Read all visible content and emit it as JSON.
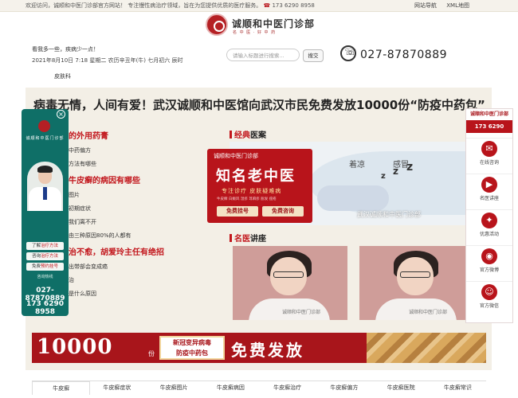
{
  "topbar": {
    "welcome": "欢迎访问，诚顺和中医门诊部官方网站！ 专注慢性病治疗领域，旨在为您提供优质的医疗服务。",
    "phone": "173 6290 8958",
    "links": [
      "网站导航",
      "XML地图"
    ]
  },
  "logo": {
    "name": "诚顺和中医门诊部",
    "tagline": "名 中 医 · 好 中 药"
  },
  "header": {
    "motto": "看我多一些，疾病少一点！",
    "date": "2021年8月10日 7:18 星期二 农历辛丑年(牛) 七月初六 辰时",
    "search_placeholder": "请输入标题进行搜索...",
    "search_button": "搜交",
    "hotline": "027-87870889",
    "nav_item": "皮肤科"
  },
  "headline": "病毒无情，人间有爱！武汉诚顺和中医馆向武汉市民免费发放10000份“防疫中药包”",
  "left_list": [
    {
      "type": "section",
      "text": "的外用药膏"
    },
    {
      "type": "item",
      "text": "中药偏方"
    },
    {
      "type": "item",
      "text": "方法有哪些"
    },
    {
      "type": "section",
      "text": "牛皮癣的病因有哪些"
    },
    {
      "type": "item",
      "text": "图片"
    },
    {
      "type": "item",
      "text": "初期症状"
    },
    {
      "type": "item",
      "text": "我们离不开"
    },
    {
      "type": "item",
      "text": "由三种原因80%的人都有"
    },
    {
      "type": "section",
      "text": "治不愈，胡爱玲主任有绝招"
    },
    {
      "type": "item",
      "text": "出带部会变成癌"
    },
    {
      "type": "item",
      "text": "治"
    },
    {
      "type": "item",
      "text": "是什么原因"
    }
  ],
  "sections": {
    "case_title_plain": "经典",
    "case_title_red": "医案",
    "lecture_title_red": "名医",
    "lecture_title_plain": "讲座"
  },
  "case_image": {
    "words": [
      "着凉",
      "感冒"
    ],
    "watermark": "武汉诚顺和中医门诊部"
  },
  "red_card": {
    "top": "诚顺和中医门诊部",
    "big": "知名老中医",
    "sub": "专注诊疗 皮肤疑难病",
    "small": "牛皮癣 白癜风 湿疹 荨麻疹 脱发 痤疮",
    "btn1": "免费挂号",
    "btn2": "免费咨询"
  },
  "lectures": [
    {
      "watermark": "诚顺和中医门诊部"
    },
    {
      "watermark": "诚顺和中医门诊部"
    }
  ],
  "banner": {
    "number": "10000",
    "unit": "份",
    "box_line1": "新冠变异病毒",
    "box_line2": "防疫中药包",
    "free": "免费发放"
  },
  "tabs": [
    "牛皮癣",
    "牛皮癣症状",
    "牛皮癣图片",
    "牛皮癣病因",
    "牛皮癣治疗",
    "牛皮癣偏方",
    "牛皮癣医院",
    "牛皮癣常识"
  ],
  "left_float": {
    "name": "诚顺和中医门诊部",
    "buttons": [
      {
        "prefix": "了解",
        "accent": "治疗方法"
      },
      {
        "prefix": "咨询",
        "accent": "治疗方法"
      },
      {
        "prefix": "免费",
        "accent": "预约挂号"
      }
    ],
    "hotline_label": "咨询热线",
    "phone1": "027-87870889",
    "phone2": "173 6290 8958"
  },
  "right_float": {
    "title": "诚顺和中医门诊部",
    "phone": "173 6290 8958",
    "items": [
      {
        "label": "在线咨询",
        "icon": "chat-icon"
      },
      {
        "label": "名医讲座",
        "icon": "video-icon"
      },
      {
        "label": "优惠活动",
        "icon": "gift-icon"
      },
      {
        "label": "官方微博",
        "icon": "weibo-icon"
      },
      {
        "label": "官方微信",
        "icon": "wechat-icon"
      }
    ]
  },
  "colors": {
    "brand_red": "#b8141b",
    "teal": "#0f6f67",
    "bg_beige": "#f3efe6"
  }
}
